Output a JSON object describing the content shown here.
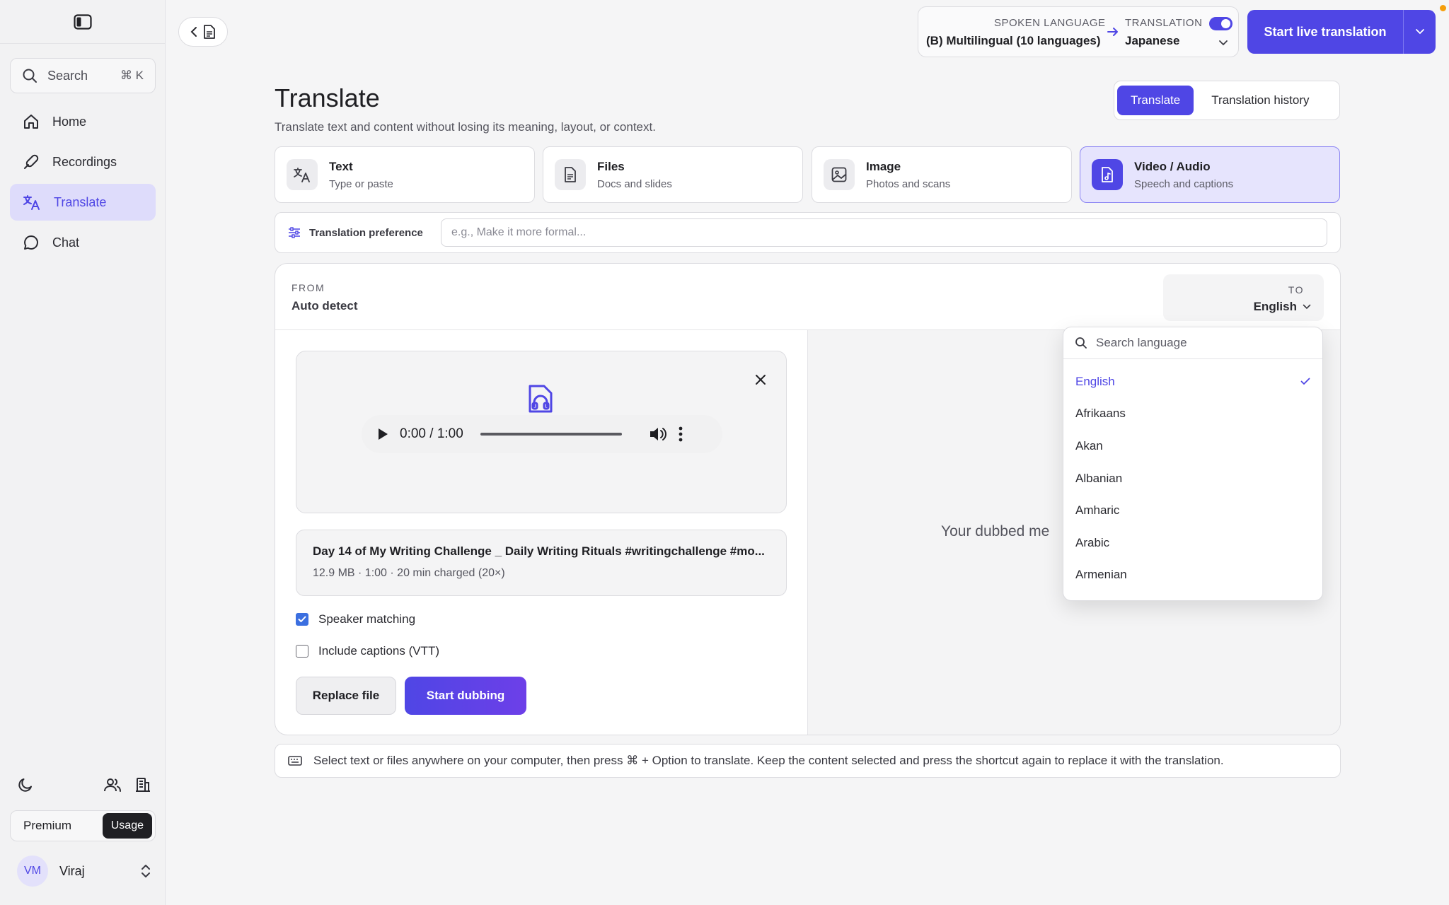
{
  "colors": {
    "accent": "#4f46e5",
    "active_bg": "#dedcfb"
  },
  "sidebar": {
    "search_label": "Search",
    "search_shortcut": "⌘ K",
    "items": [
      {
        "label": "Home",
        "icon": "home-icon"
      },
      {
        "label": "Recordings",
        "icon": "microphone-icon"
      },
      {
        "label": "Translate",
        "icon": "translate-icon"
      },
      {
        "label": "Chat",
        "icon": "chat-bubble-icon"
      }
    ],
    "plan": {
      "premium": "Premium",
      "usage": "Usage"
    },
    "user": {
      "initials": "VM",
      "name": "Viraj"
    }
  },
  "topbar": {
    "spoken_label": "SPOKEN LANGUAGE",
    "spoken_value": "(B) Multilingual (10 languages)",
    "translation_label": "TRANSLATION",
    "translation_value": "Japanese",
    "live_button": "Start live translation"
  },
  "header": {
    "title": "Translate",
    "subtitle": "Translate text and content without losing its meaning, layout, or context.",
    "tabs": [
      "Translate",
      "Translation history"
    ]
  },
  "modes": [
    {
      "title": "Text",
      "sub": "Type or paste"
    },
    {
      "title": "Files",
      "sub": "Docs and slides"
    },
    {
      "title": "Image",
      "sub": "Photos and scans"
    },
    {
      "title": "Video / Audio",
      "sub": "Speech and captions"
    }
  ],
  "preference": {
    "label": "Translation preference",
    "placeholder": "e.g., Make it more formal..."
  },
  "card": {
    "from_label": "FROM",
    "from_value": "Auto detect",
    "to_label": "TO",
    "to_value": "English",
    "player_time": "0:00 / 1:00",
    "file_name": "Day 14 of My Writing Challenge _ Daily Writing Rituals #writingchallenge #mo...",
    "file_meta": "12.9 MB · 1:00 · 20 min charged (20×)",
    "speaker_matching": "Speaker matching",
    "include_captions": "Include captions (VTT)",
    "replace_button": "Replace file",
    "dub_button": "Start dubbing",
    "dubbed_placeholder": "Your dubbed me"
  },
  "dropdown": {
    "search_placeholder": "Search language",
    "languages": [
      "English",
      "Afrikaans",
      "Akan",
      "Albanian",
      "Amharic",
      "Arabic",
      "Armenian"
    ]
  },
  "shortcut_hint": "Select text or files anywhere on your computer, then press ⌘ + Option to translate. Keep the content selected and press the shortcut again to replace it with the translation."
}
